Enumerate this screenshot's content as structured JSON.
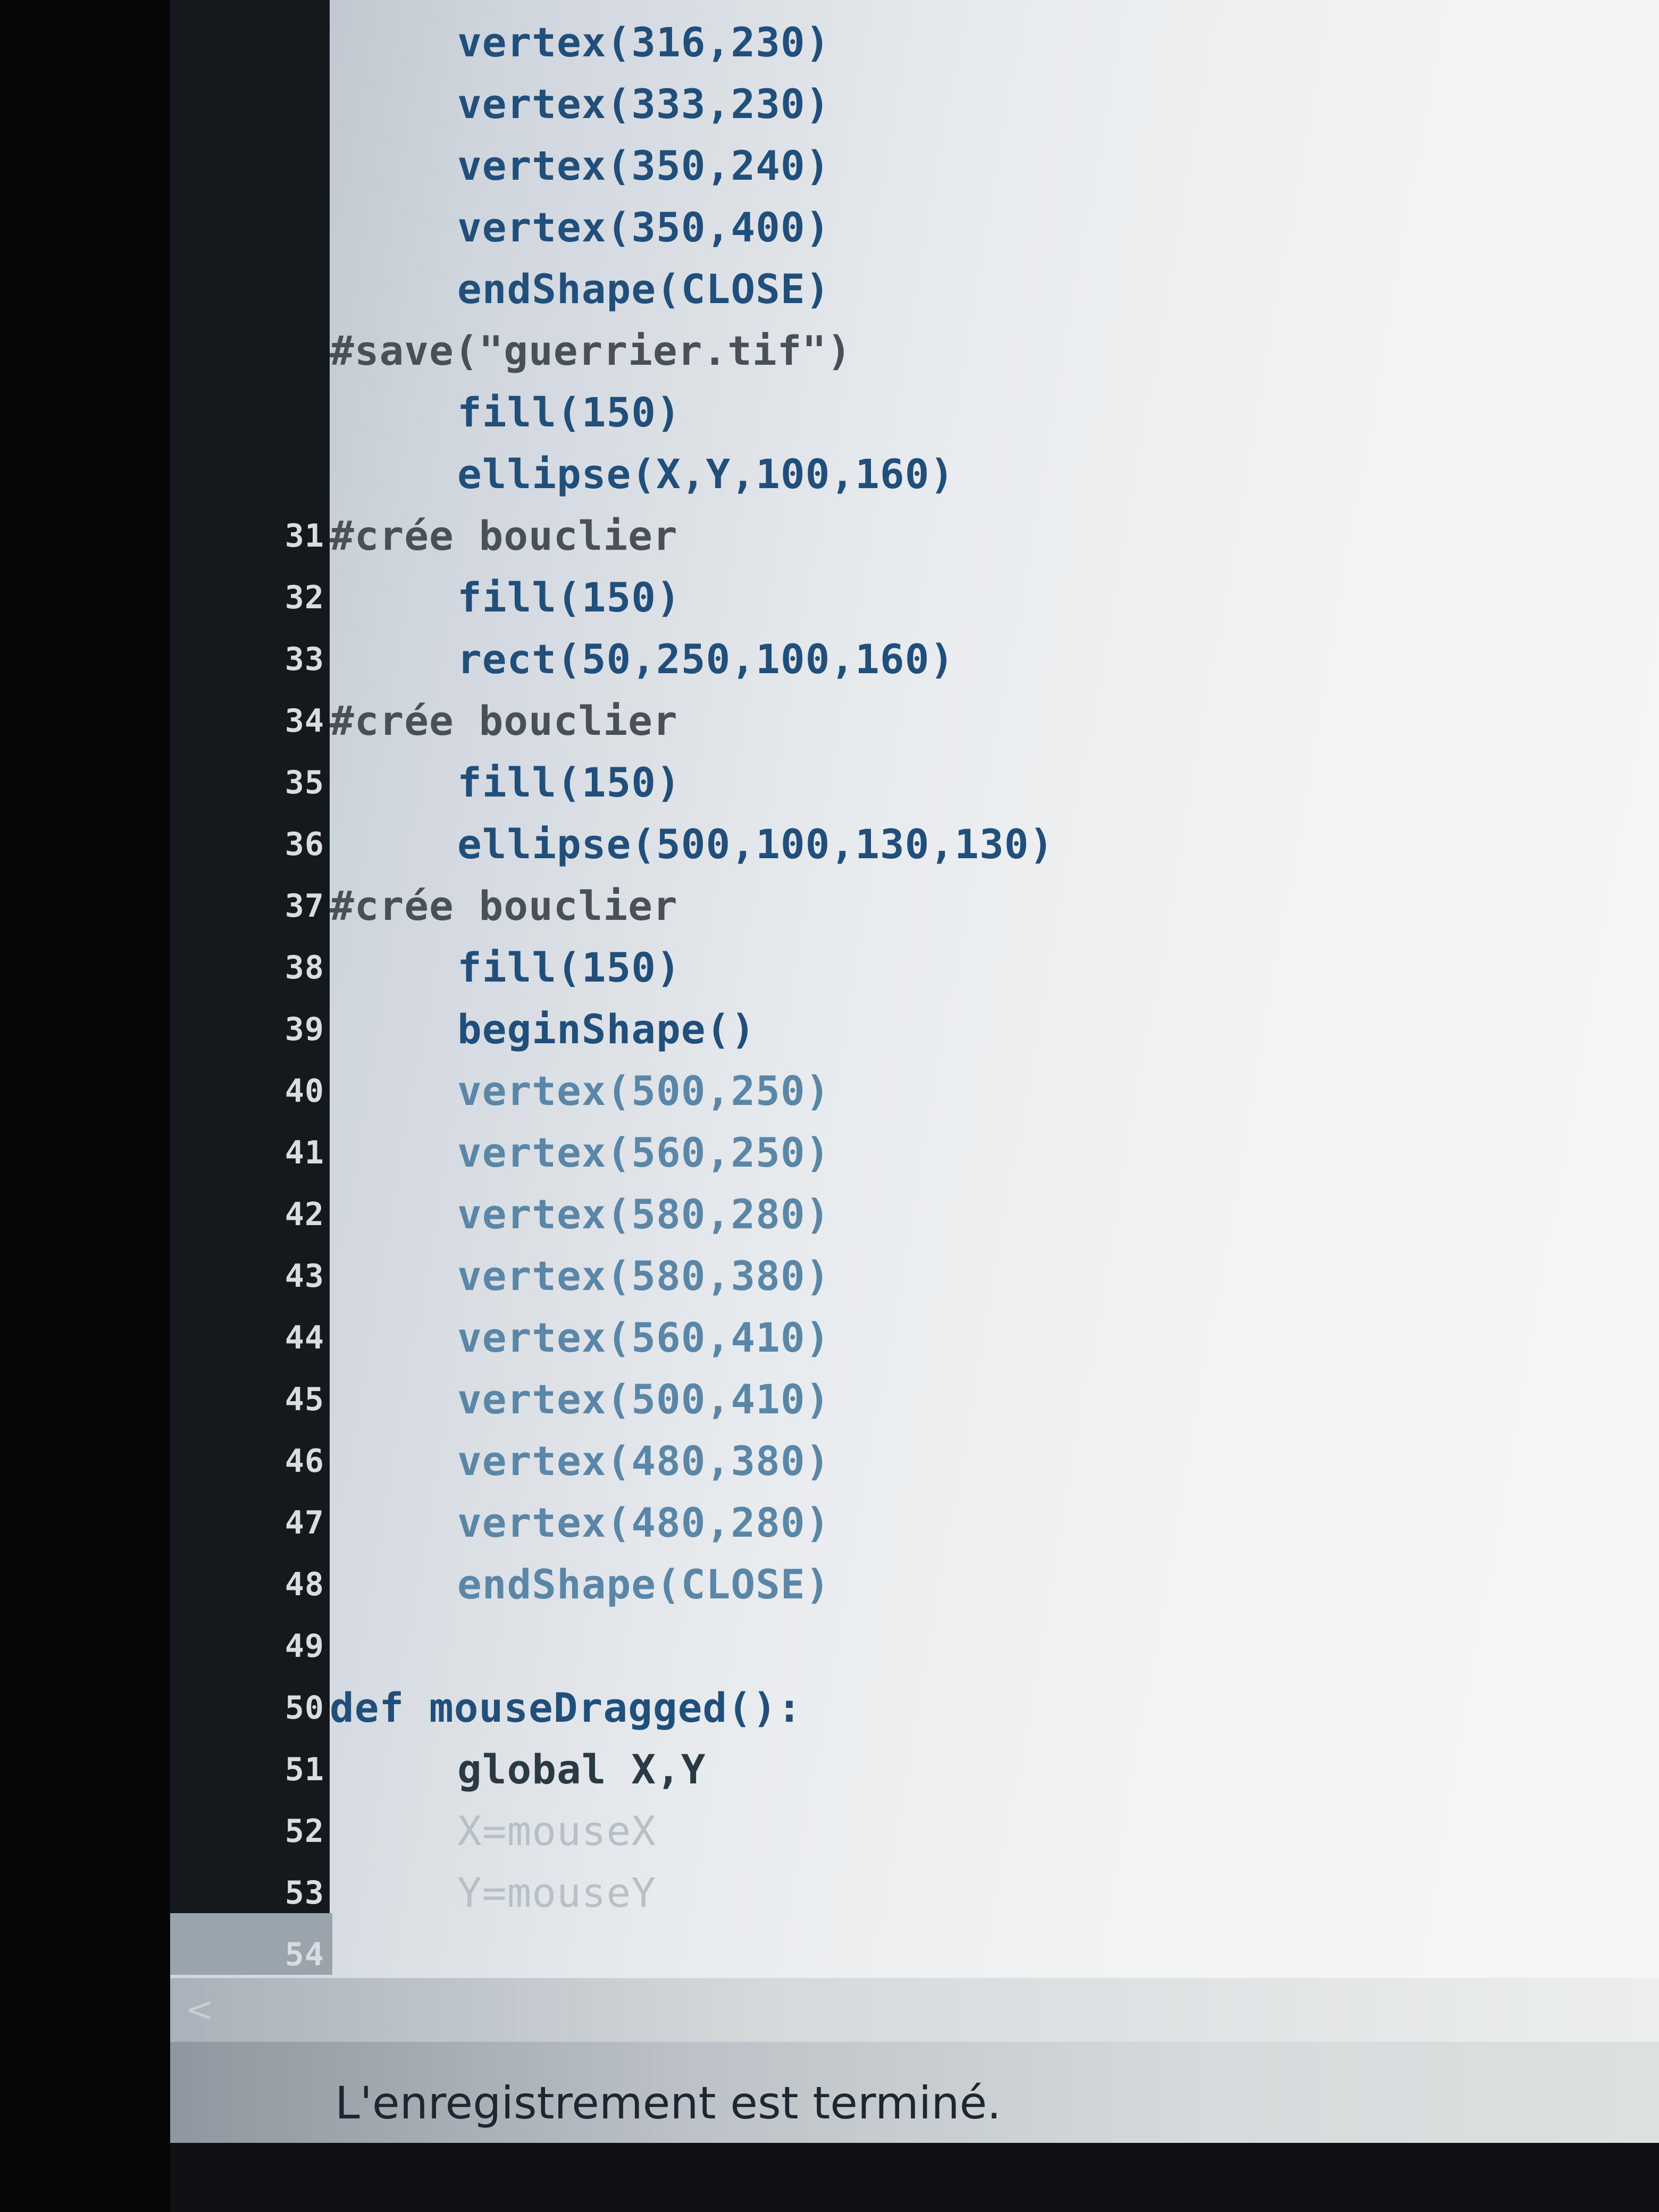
{
  "editor": {
    "lines": [
      {
        "number": "",
        "indent": true,
        "style": "func",
        "text": "vertex(316,230)"
      },
      {
        "number": "",
        "indent": true,
        "style": "func",
        "text": "vertex(333,230)"
      },
      {
        "number": "",
        "indent": true,
        "style": "func",
        "text": "vertex(350,240)"
      },
      {
        "number": "",
        "indent": true,
        "style": "func",
        "text": "vertex(350,400)"
      },
      {
        "number": "",
        "indent": true,
        "style": "func",
        "text": "endShape(CLOSE)"
      },
      {
        "number": "",
        "indent": false,
        "style": "comment",
        "text": "#save(\"guerrier.tif\")"
      },
      {
        "number": "",
        "indent": true,
        "style": "func",
        "text": "fill(150)"
      },
      {
        "number": "",
        "indent": true,
        "style": "func",
        "text": "ellipse(X,Y,100,160)"
      },
      {
        "number": "31",
        "indent": false,
        "style": "comment",
        "text": "#crée bouclier"
      },
      {
        "number": "32",
        "indent": true,
        "style": "func",
        "text": "fill(150)"
      },
      {
        "number": "33",
        "indent": true,
        "style": "func",
        "text": "rect(50,250,100,160)"
      },
      {
        "number": "34",
        "indent": false,
        "style": "comment",
        "text": "#crée bouclier"
      },
      {
        "number": "35",
        "indent": true,
        "style": "func",
        "text": "fill(150)"
      },
      {
        "number": "36",
        "indent": true,
        "style": "func",
        "text": "ellipse(500,100,130,130)"
      },
      {
        "number": "37",
        "indent": false,
        "style": "comment",
        "text": "#crée bouclier"
      },
      {
        "number": "38",
        "indent": true,
        "style": "func",
        "text": "fill(150)"
      },
      {
        "number": "39",
        "indent": true,
        "style": "func",
        "text": "beginShape()"
      },
      {
        "number": "40",
        "indent": true,
        "style": "fade",
        "text": "vertex(500,250)"
      },
      {
        "number": "41",
        "indent": true,
        "style": "fade",
        "text": "vertex(560,250)"
      },
      {
        "number": "42",
        "indent": true,
        "style": "fade",
        "text": "vertex(580,280)"
      },
      {
        "number": "43",
        "indent": true,
        "style": "fade",
        "text": "vertex(580,380)"
      },
      {
        "number": "44",
        "indent": true,
        "style": "fade",
        "text": "vertex(560,410)"
      },
      {
        "number": "45",
        "indent": true,
        "style": "fade",
        "text": "vertex(500,410)"
      },
      {
        "number": "46",
        "indent": true,
        "style": "fade",
        "text": "vertex(480,380)"
      },
      {
        "number": "47",
        "indent": true,
        "style": "fade",
        "text": "vertex(480,280)"
      },
      {
        "number": "48",
        "indent": true,
        "style": "fade",
        "text": "endShape(CLOSE)"
      },
      {
        "number": "49",
        "indent": false,
        "style": "plain",
        "text": ""
      },
      {
        "number": "50",
        "indent": false,
        "style": "def",
        "text": "def mouseDragged():"
      },
      {
        "number": "51",
        "indent": true,
        "style": "global",
        "text": "global X,Y"
      },
      {
        "number": "52",
        "indent": true,
        "style": "assign",
        "text": "X=mouseX"
      },
      {
        "number": "53",
        "indent": true,
        "style": "assign",
        "text": "Y=mouseY"
      },
      {
        "number": "54",
        "indent": false,
        "style": "plain",
        "text": ""
      }
    ]
  },
  "scrollbar": {
    "left_arrow": "<"
  },
  "status": {
    "message": "L'enregistrement est terminé."
  },
  "colors": {
    "gutter": "#15191e",
    "comment": "#4a5057",
    "function": "#1f4f7a",
    "keyword": "#7fa2b5"
  }
}
